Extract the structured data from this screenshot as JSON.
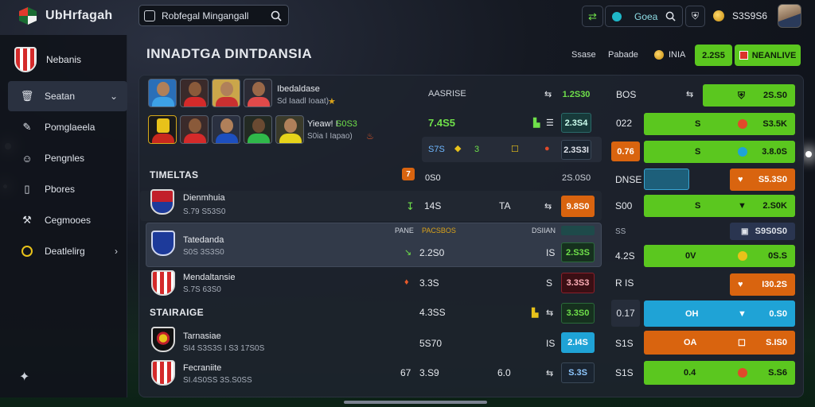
{
  "app": {
    "title": "UbHrfagah"
  },
  "search": {
    "value": "Robfegal Mingangall"
  },
  "topbar": {
    "btn_label": "Goea",
    "balance": "S3S9S6"
  },
  "sidebar": {
    "team": "Nebanis",
    "items": [
      {
        "label": "Seatan",
        "icon": "trash-icon",
        "active": true,
        "chevron": "⌄"
      },
      {
        "label": "Pomglaeela",
        "icon": "pencil-icon",
        "active": false,
        "chevron": ""
      },
      {
        "label": "Pengnles",
        "icon": "users-icon",
        "active": false,
        "chevron": ""
      },
      {
        "label": "Pbores",
        "icon": "phone-icon",
        "active": false,
        "chevron": ""
      },
      {
        "label": "Cegmooes",
        "icon": "wrench-icon",
        "active": false,
        "chevron": ""
      },
      {
        "label": "Deatlelirg",
        "icon": "circle-icon",
        "active": false,
        "chevron": "›"
      }
    ]
  },
  "header": {
    "title": "INNADTGA DINTDANSIA",
    "link1": "Ssase",
    "link2": "Pabade",
    "coin_label": "INIA",
    "pill1": "2.2S5",
    "pill2": "NEANLIVE"
  },
  "squad": {
    "name1": "Ibedaldase",
    "sub1": "Sd Iaadl Ioaat)",
    "name2": "Yieaw! I",
    "name2b": "S0S3",
    "sub2": "S0ia I Iapao)"
  },
  "top_stats": {
    "h1": "AASRISE",
    "v1": "1.2S30",
    "r2": "7.4S5",
    "v2": "2.3S4",
    "r3a": "S7S",
    "r3b": "3",
    "v3": "2.3S3I"
  },
  "right_top": {
    "r1": "BOS",
    "r1v": "2S.S0",
    "r2": "022",
    "r2n": "S",
    "r2v": "S3.5K",
    "r3": "0.76",
    "r3n": "S",
    "r3v": "3.8.0S"
  },
  "fixtures": {
    "title": "TIMELTAS",
    "badge": "7",
    "val": "0S0",
    "val2": "2S.0S0",
    "right_label": "DNSE",
    "right_val": "S5.3S0",
    "rows": [
      {
        "name": "Dienmhuia",
        "sub": "S.79 S53S0",
        "n1": "14S",
        "n2": "TA",
        "box": "9.8S0",
        "rl": "S00",
        "rn": "S",
        "rv": "2.S0K"
      },
      {
        "name": "Tatedanda",
        "sub": "S0S 3S3S0",
        "hd1": "PANE",
        "hd2": "PACSBOS",
        "hd3": "DSIIAN",
        "n1": "2.2S0",
        "n2": "IS",
        "box": "2.S3S",
        "rl": "4.2S",
        "rt": "0V",
        "rv": "0S.S",
        "hdr_r": "SS",
        "hdr_v": "S9S0S0"
      },
      {
        "name": "Mendaltansie",
        "sub": "S.7S 63S0",
        "n1": "3.3S",
        "n2": "S",
        "box": "3.3S3",
        "rl": "R IS",
        "rv": "I30.2S"
      }
    ]
  },
  "standings": {
    "title": "STAIRAIGE",
    "val": "4.3SS",
    "box0": "3.3S0",
    "r0": "0.17",
    "r0t": "OH",
    "r0v": "0.S0",
    "rows": [
      {
        "name": "Tarnasiae",
        "sub": "SI4 S3S3S I S3 17S0S",
        "n1": "5S70",
        "n2": "IS",
        "box": "2.I4S",
        "rl": "S1S",
        "rt": "OA",
        "rv": "S.IS0"
      },
      {
        "name": "Fecraniite",
        "sub": "SI.4S0SS 3S.S0SS",
        "n0": "67",
        "n1": "3.S9",
        "n2": "6.0",
        "box": "S.3S",
        "rl": "S1S",
        "rt": "0.4",
        "rv": "S.S6"
      }
    ]
  },
  "colors": {
    "green": "#5bc71f",
    "orange": "#d9640f",
    "blue": "#1fa3d6",
    "teal": "#1e5f6a"
  }
}
